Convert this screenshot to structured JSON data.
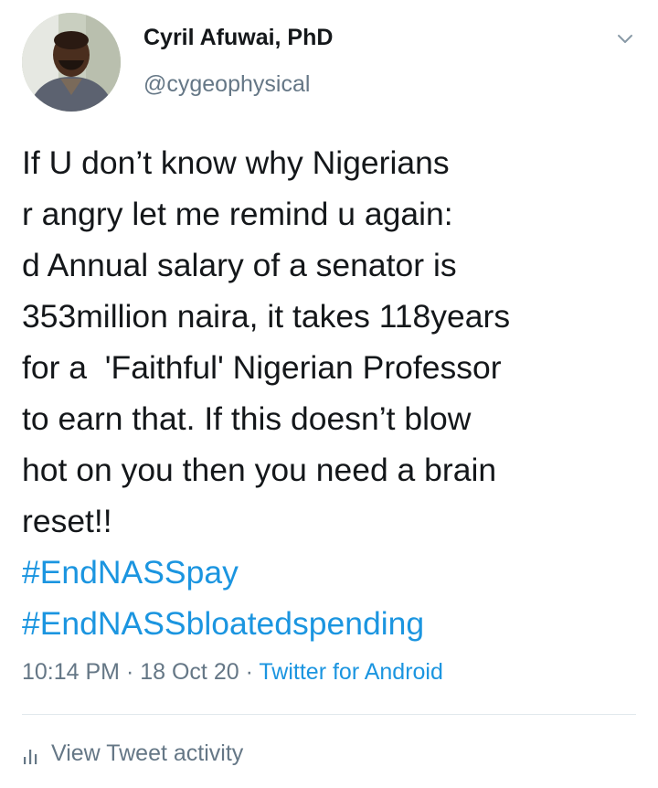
{
  "user": {
    "display_name": "Cyril Afuwai, PhD",
    "handle": "@cygeophysical",
    "avatar_icon": "profile-photo"
  },
  "menu_icon": "chevron-down-icon",
  "tweet": {
    "lines": [
      "If U don’t know why Nigerians",
      "r angry let me remind u again:",
      "d Annual salary of a senator is",
      "353million naira, it takes 118years",
      "for a  'Faithful' Nigerian Professor",
      "to earn that. If this doesn’t blow",
      "hot on you then you need a brain",
      "reset!!"
    ],
    "hashtags": [
      "#EndNASSpay",
      "#EndNASSbloatedspending"
    ]
  },
  "meta": {
    "time": "10:14 PM",
    "separator": " · ",
    "date": "18 Oct 20",
    "source": "Twitter for Android"
  },
  "activity": {
    "icon": "bar-chart-icon",
    "label": "View Tweet activity"
  },
  "colors": {
    "link": "#1b95e0",
    "secondary_text": "#657786",
    "primary_text": "#14171a",
    "divider": "#e1e8ed"
  }
}
